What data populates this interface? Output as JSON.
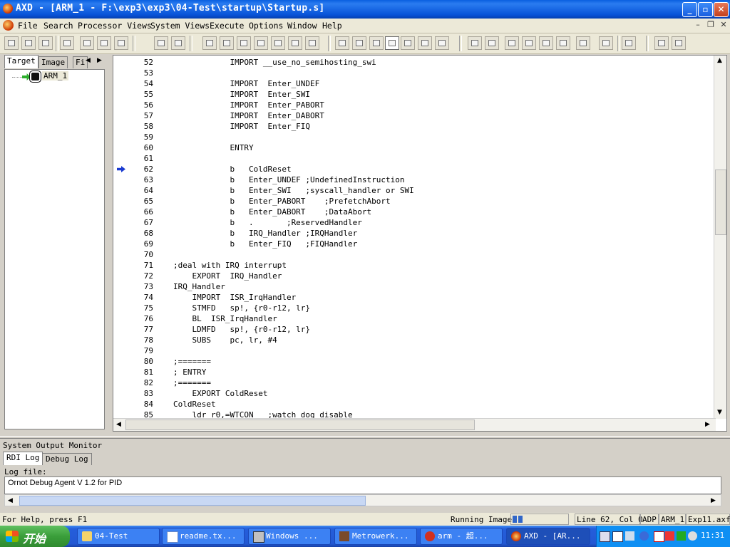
{
  "window": {
    "title": "AXD - [ARM_1 - F:\\exp3\\exp3\\04-Test\\startup\\Startup.s]"
  },
  "menu": [
    "File",
    "Search",
    "Processor Views",
    "System Views",
    "Execute",
    "Options",
    "Window",
    "Help"
  ],
  "left_panel": {
    "tabs": [
      "Target",
      "Image",
      "Fi"
    ],
    "tree_item": "ARM_1"
  },
  "source": {
    "current_line": 62,
    "lines": [
      {
        "n": "52",
        "text": "            IMPORT __use_no_semihosting_swi"
      },
      {
        "n": "53",
        "text": ""
      },
      {
        "n": "54",
        "text": "            IMPORT  Enter_UNDEF"
      },
      {
        "n": "55",
        "text": "            IMPORT  Enter_SWI"
      },
      {
        "n": "56",
        "text": "            IMPORT  Enter_PABORT"
      },
      {
        "n": "57",
        "text": "            IMPORT  Enter_DABORT"
      },
      {
        "n": "58",
        "text": "            IMPORT  Enter_FIQ"
      },
      {
        "n": "59",
        "text": ""
      },
      {
        "n": "60",
        "text": "            ENTRY"
      },
      {
        "n": "61",
        "text": ""
      },
      {
        "n": "62",
        "text": "            b   ColdReset"
      },
      {
        "n": "63",
        "text": "            b   Enter_UNDEF ;UndefinedInstruction"
      },
      {
        "n": "64",
        "text": "            b   Enter_SWI   ;syscall_handler or SWI"
      },
      {
        "n": "65",
        "text": "            b   Enter_PABORT    ;PrefetchAbort"
      },
      {
        "n": "66",
        "text": "            b   Enter_DABORT    ;DataAbort"
      },
      {
        "n": "67",
        "text": "            b   .       ;ReservedHandler"
      },
      {
        "n": "68",
        "text": "            b   IRQ_Handler ;IRQHandler"
      },
      {
        "n": "69",
        "text": "            b   Enter_FIQ   ;FIQHandler"
      },
      {
        "n": "70",
        "text": ""
      },
      {
        "n": "71",
        "text": ";deal with IRQ interrupt"
      },
      {
        "n": "72",
        "text": "    EXPORT  IRQ_Handler"
      },
      {
        "n": "73",
        "text": "IRQ_Handler"
      },
      {
        "n": "74",
        "text": "    IMPORT  ISR_IrqHandler"
      },
      {
        "n": "75",
        "text": "    STMFD   sp!, {r0-r12, lr}"
      },
      {
        "n": "76",
        "text": "    BL  ISR_IrqHandler"
      },
      {
        "n": "77",
        "text": "    LDMFD   sp!, {r0-r12, lr}"
      },
      {
        "n": "78",
        "text": "    SUBS    pc, lr, #4"
      },
      {
        "n": "79",
        "text": ""
      },
      {
        "n": "80",
        "text": ";======="
      },
      {
        "n": "81",
        "text": "; ENTRY"
      },
      {
        "n": "82",
        "text": ";======="
      },
      {
        "n": "83",
        "text": "    EXPORT ColdReset"
      },
      {
        "n": "84",
        "text": "ColdReset"
      },
      {
        "n": "85",
        "text": "    ldr r0,=WTCON   ;watch dog disable"
      }
    ]
  },
  "output": {
    "title": "System Output Monitor",
    "tabs": [
      "RDI Log",
      "Debug Log"
    ],
    "logfile_label": "Log file:",
    "log_text": "Ornot Debug Agent V 1.2 for PID"
  },
  "statusbar": {
    "help": "For Help, press F1",
    "running": "Running Image",
    "position": "Line 62, Col 0",
    "mode": "ADP",
    "target": "ARM_1",
    "image": "Exp11.axf"
  },
  "taskbar": {
    "start": "开始",
    "tasks": [
      "04-Test",
      "readme.tx...",
      "Windows ...",
      "Metrowerk...",
      "arm - 超...",
      "AXD - [AR..."
    ],
    "clock": "11:31"
  },
  "icons": {
    "app": "axd-app-icon",
    "current_line_marker": "blue-arrow-icon"
  }
}
